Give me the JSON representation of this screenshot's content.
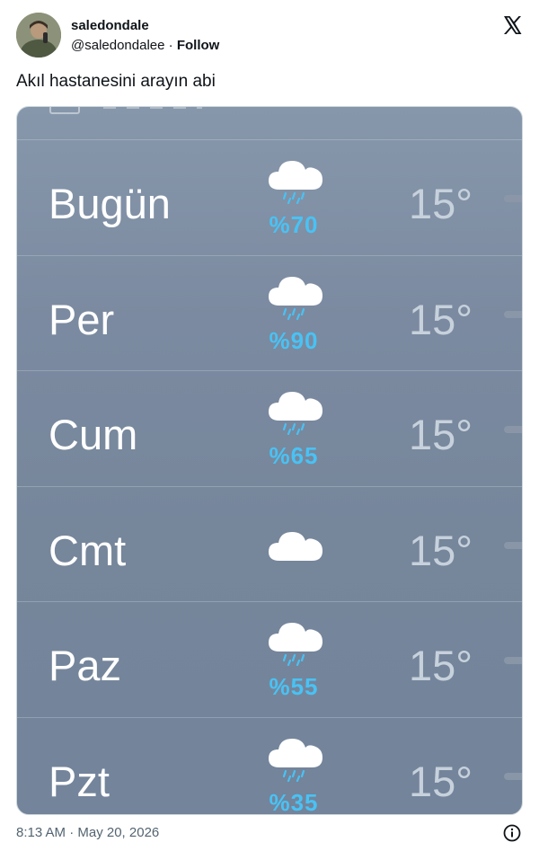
{
  "tweet": {
    "display_name": "saledondale",
    "handle": "@saledondalee",
    "separator": "·",
    "follow_label": "Follow",
    "text": "Akıl hastanesini arayın abi",
    "timestamp": "8:13 AM · May 20, 2026"
  },
  "weather": {
    "rows": [
      {
        "day": "Bugün",
        "temp": "15°",
        "icon": "cloud-rain-icon",
        "precip": "%70"
      },
      {
        "day": "Per",
        "temp": "15°",
        "icon": "cloud-rain-icon",
        "precip": "%90"
      },
      {
        "day": "Cum",
        "temp": "15°",
        "icon": "cloud-rain-icon",
        "precip": "%65"
      },
      {
        "day": "Cmt",
        "temp": "15°",
        "icon": "cloud-icon",
        "precip": ""
      },
      {
        "day": "Paz",
        "temp": "15°",
        "icon": "cloud-rain-icon",
        "precip": "%55"
      },
      {
        "day": "Pzt",
        "temp": "15°",
        "icon": "cloud-rain-icon",
        "precip": "%35"
      }
    ]
  },
  "colors": {
    "precip_text": "#49c2f4",
    "panel_bg": "#7b8aa0"
  }
}
